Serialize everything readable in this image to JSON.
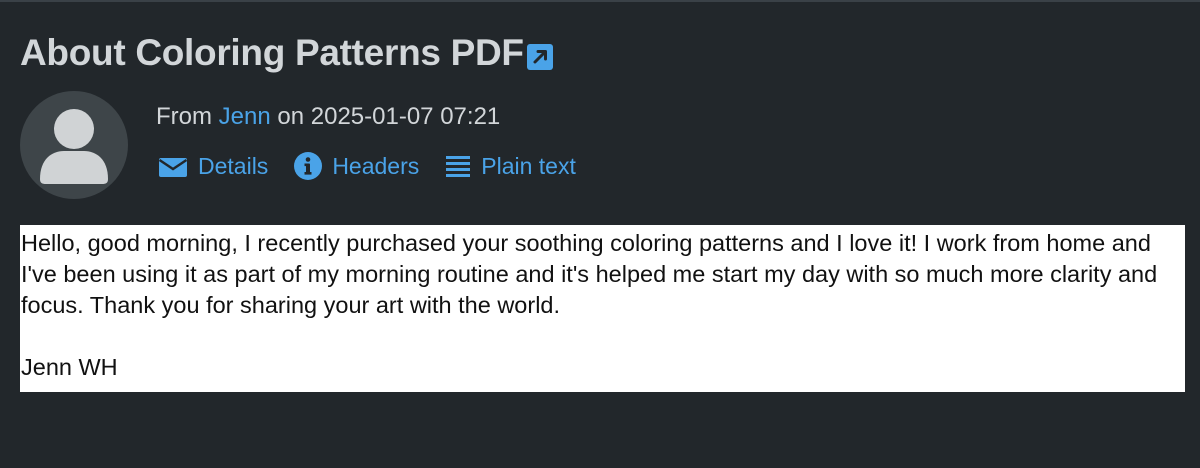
{
  "message": {
    "title": "About Coloring Patterns PDF",
    "from_prefix": "From",
    "sender": "Jenn",
    "on_word": "on",
    "timestamp": "2025-01-07 07:21",
    "actions": [
      {
        "label": "Details",
        "icon": "envelope-icon"
      },
      {
        "label": "Headers",
        "icon": "info-icon"
      },
      {
        "label": "Plain text",
        "icon": "lines-icon"
      }
    ],
    "body": "Hello, good morning, I recently purchased your soothing coloring patterns and I love it! I work from home and I've been using it as part of my morning routine and it's helped me start my day with so much more clarity and focus. Thank you for sharing your art with the world.",
    "signature": "Jenn WH"
  },
  "colors": {
    "background": "#22272b",
    "link": "#4aa3e8",
    "title": "#d2d6d9",
    "body_bg": "#ffffff"
  }
}
